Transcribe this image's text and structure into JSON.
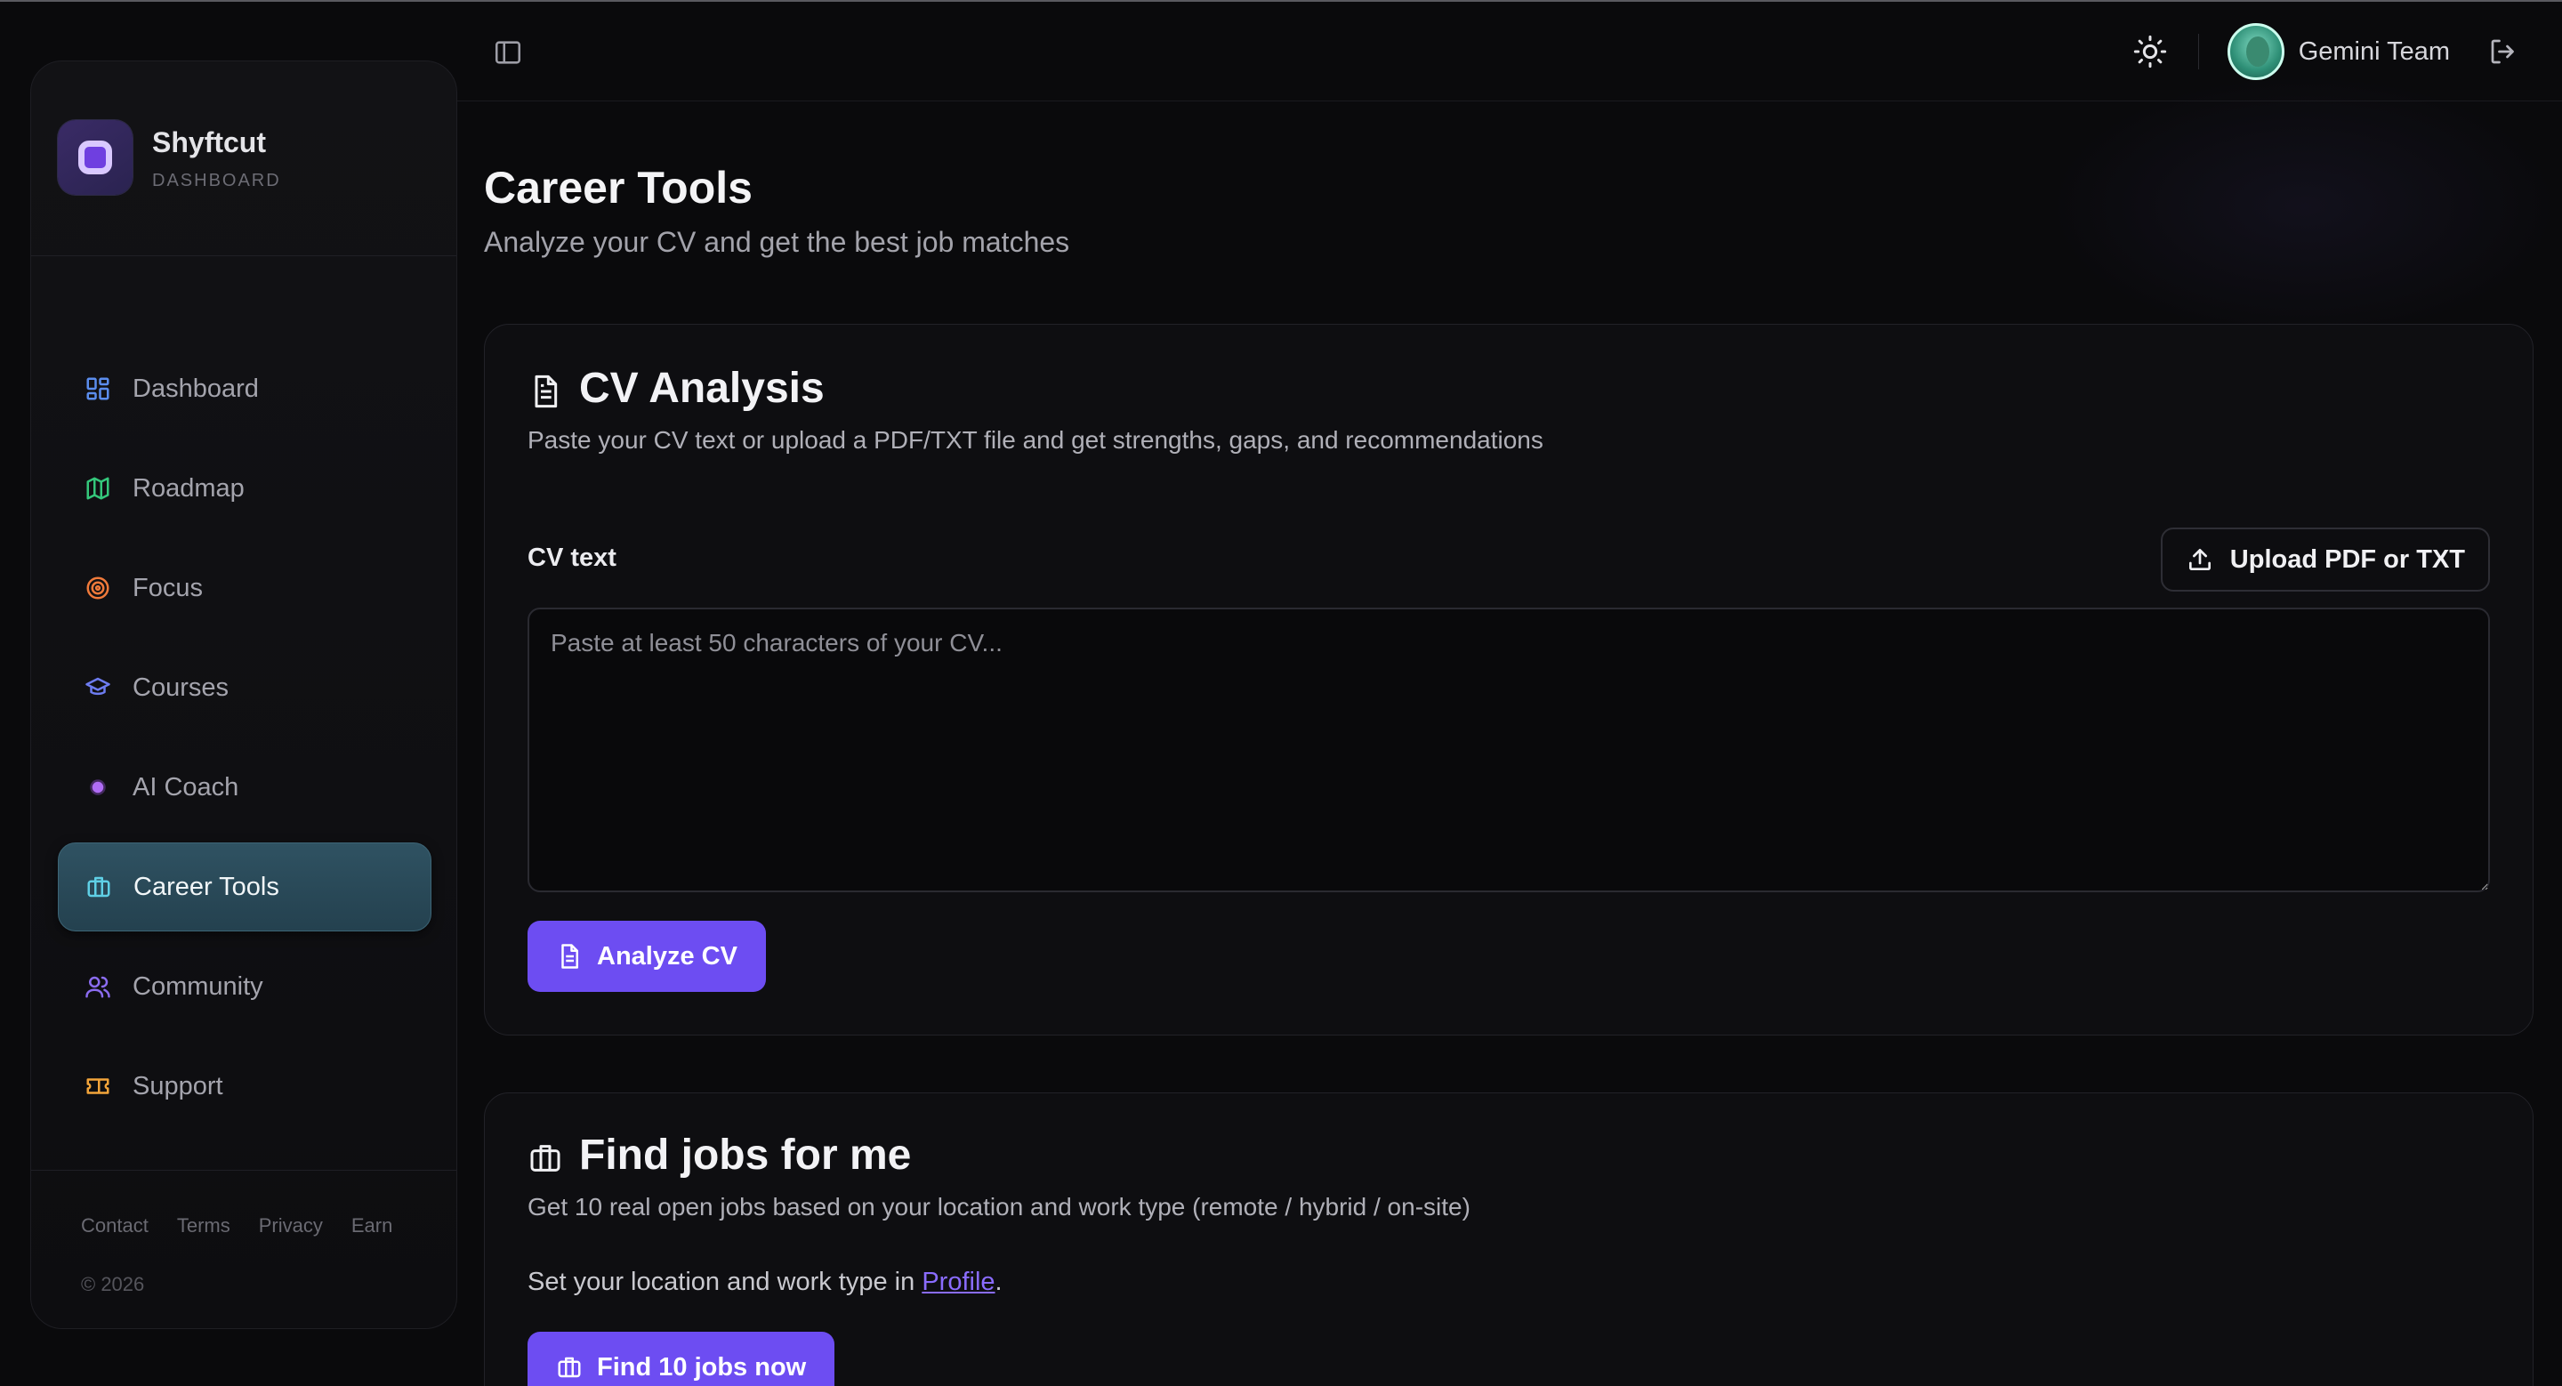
{
  "brand": {
    "name": "Shyftcut",
    "subtitle": "DASHBOARD"
  },
  "sidebar": {
    "items": [
      {
        "label": "Dashboard",
        "icon": "dashboard-icon",
        "color": "#5b8dee"
      },
      {
        "label": "Roadmap",
        "icon": "map-icon",
        "color": "#34c77b"
      },
      {
        "label": "Focus",
        "icon": "target-icon",
        "color": "#f07a3a"
      },
      {
        "label": "Courses",
        "icon": "graduation-cap-icon",
        "color": "#6d7cf0"
      },
      {
        "label": "AI Coach",
        "icon": "sparkle-dot-icon",
        "color": "#a65cf0"
      },
      {
        "label": "Career Tools",
        "icon": "briefcase-icon",
        "color": "#5fd0e6",
        "active": true
      },
      {
        "label": "Community",
        "icon": "users-icon",
        "color": "#8b6cf0"
      },
      {
        "label": "Support",
        "icon": "ticket-icon",
        "color": "#f2a43a"
      }
    ],
    "footer_links": [
      "Contact",
      "Terms",
      "Privacy",
      "Earn"
    ],
    "copyright": "© 2026"
  },
  "topbar": {
    "user_name": "Gemini Team"
  },
  "page": {
    "title": "Career Tools",
    "subtitle": "Analyze your CV and get the best job matches"
  },
  "cv_card": {
    "title": "CV Analysis",
    "subtitle": "Paste your CV text or upload a PDF/TXT file and get strengths, gaps, and recommendations",
    "label": "CV text",
    "upload_label": "Upload PDF or TXT",
    "textarea_value": "",
    "textarea_placeholder": "Paste at least 50 characters of your CV...",
    "analyze_label": "Analyze CV"
  },
  "jobs_card": {
    "title": "Find jobs for me",
    "subtitle": "Get 10 real open jobs based on your location and work type (remote / hybrid / on-site)",
    "note_prefix": "Set your location and work type in ",
    "note_link": "Profile",
    "note_suffix": ".",
    "find_label": "Find 10 jobs now"
  },
  "colors": {
    "accent": "#6d4df2",
    "active_nav": "#2f5262",
    "background": "#0a0a0c"
  }
}
